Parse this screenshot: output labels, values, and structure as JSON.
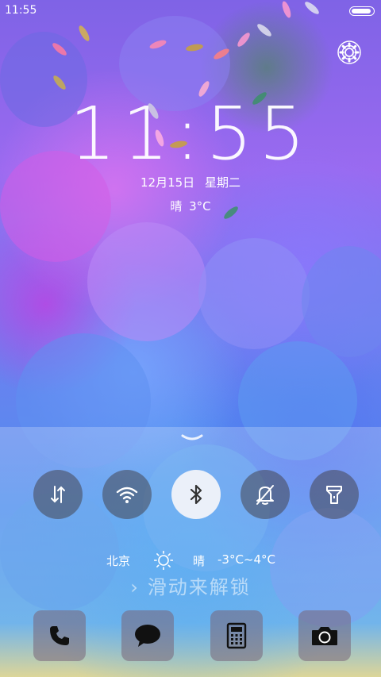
{
  "status_bar": {
    "time": "11:55"
  },
  "lock": {
    "clock": "11:55",
    "date": "12月15日",
    "weekday": "星期二",
    "weather_condition": "晴",
    "temperature": "3°C"
  },
  "quick_toggles": [
    {
      "name": "data",
      "icon": "data-transfer-icon",
      "active": false
    },
    {
      "name": "wifi",
      "icon": "wifi-icon",
      "active": false
    },
    {
      "name": "bluetooth",
      "icon": "bluetooth-icon",
      "active": true
    },
    {
      "name": "silent",
      "icon": "bell-off-icon",
      "active": false
    },
    {
      "name": "flashlight",
      "icon": "flashlight-icon",
      "active": false
    }
  ],
  "weather_bar": {
    "city": "北京",
    "condition": "晴",
    "range": "-3°C~4°C"
  },
  "unlock": {
    "label": "滑动来解锁",
    "arrow": "›"
  },
  "dock": [
    {
      "name": "phone",
      "icon": "phone-icon"
    },
    {
      "name": "messages",
      "icon": "message-icon"
    },
    {
      "name": "calculator",
      "icon": "calculator-icon"
    },
    {
      "name": "camera",
      "icon": "camera-icon"
    }
  ],
  "colors": {
    "accent": "#ffffff",
    "toggle_active": "#f5f5fa",
    "toggle_inactive": "#46465066"
  }
}
